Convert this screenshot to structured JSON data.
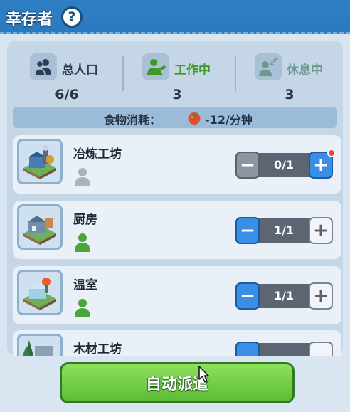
{
  "header": {
    "title": "幸存者",
    "help": "?"
  },
  "stats": {
    "population": {
      "label": "总人口",
      "value": "6/6",
      "icon": "people-icon"
    },
    "working": {
      "label": "工作中",
      "value": "3",
      "icon": "worker-icon"
    },
    "resting": {
      "label": "休息中",
      "value": "3",
      "icon": "sleep-icon"
    }
  },
  "food": {
    "label": "食物消耗：",
    "value": "-12/分钟",
    "icon": "tomato-icon"
  },
  "buildings": [
    {
      "name": "冶炼工坊",
      "count": "0/1",
      "worker_status": "idle"
    },
    {
      "name": "厨房",
      "count": "1/1",
      "worker_status": "assigned"
    },
    {
      "name": "温室",
      "count": "1/1",
      "worker_status": "assigned"
    },
    {
      "name": "木材工坊",
      "count": "",
      "worker_status": ""
    }
  ],
  "colors": {
    "header": "#2f7fc4",
    "accent_green": "#5dbb35",
    "working_green": "#3f9a2a",
    "resting_teal": "#6f9890",
    "minus_blue": "#3a8ee6"
  },
  "auto_button": {
    "label": "自动派遣"
  }
}
